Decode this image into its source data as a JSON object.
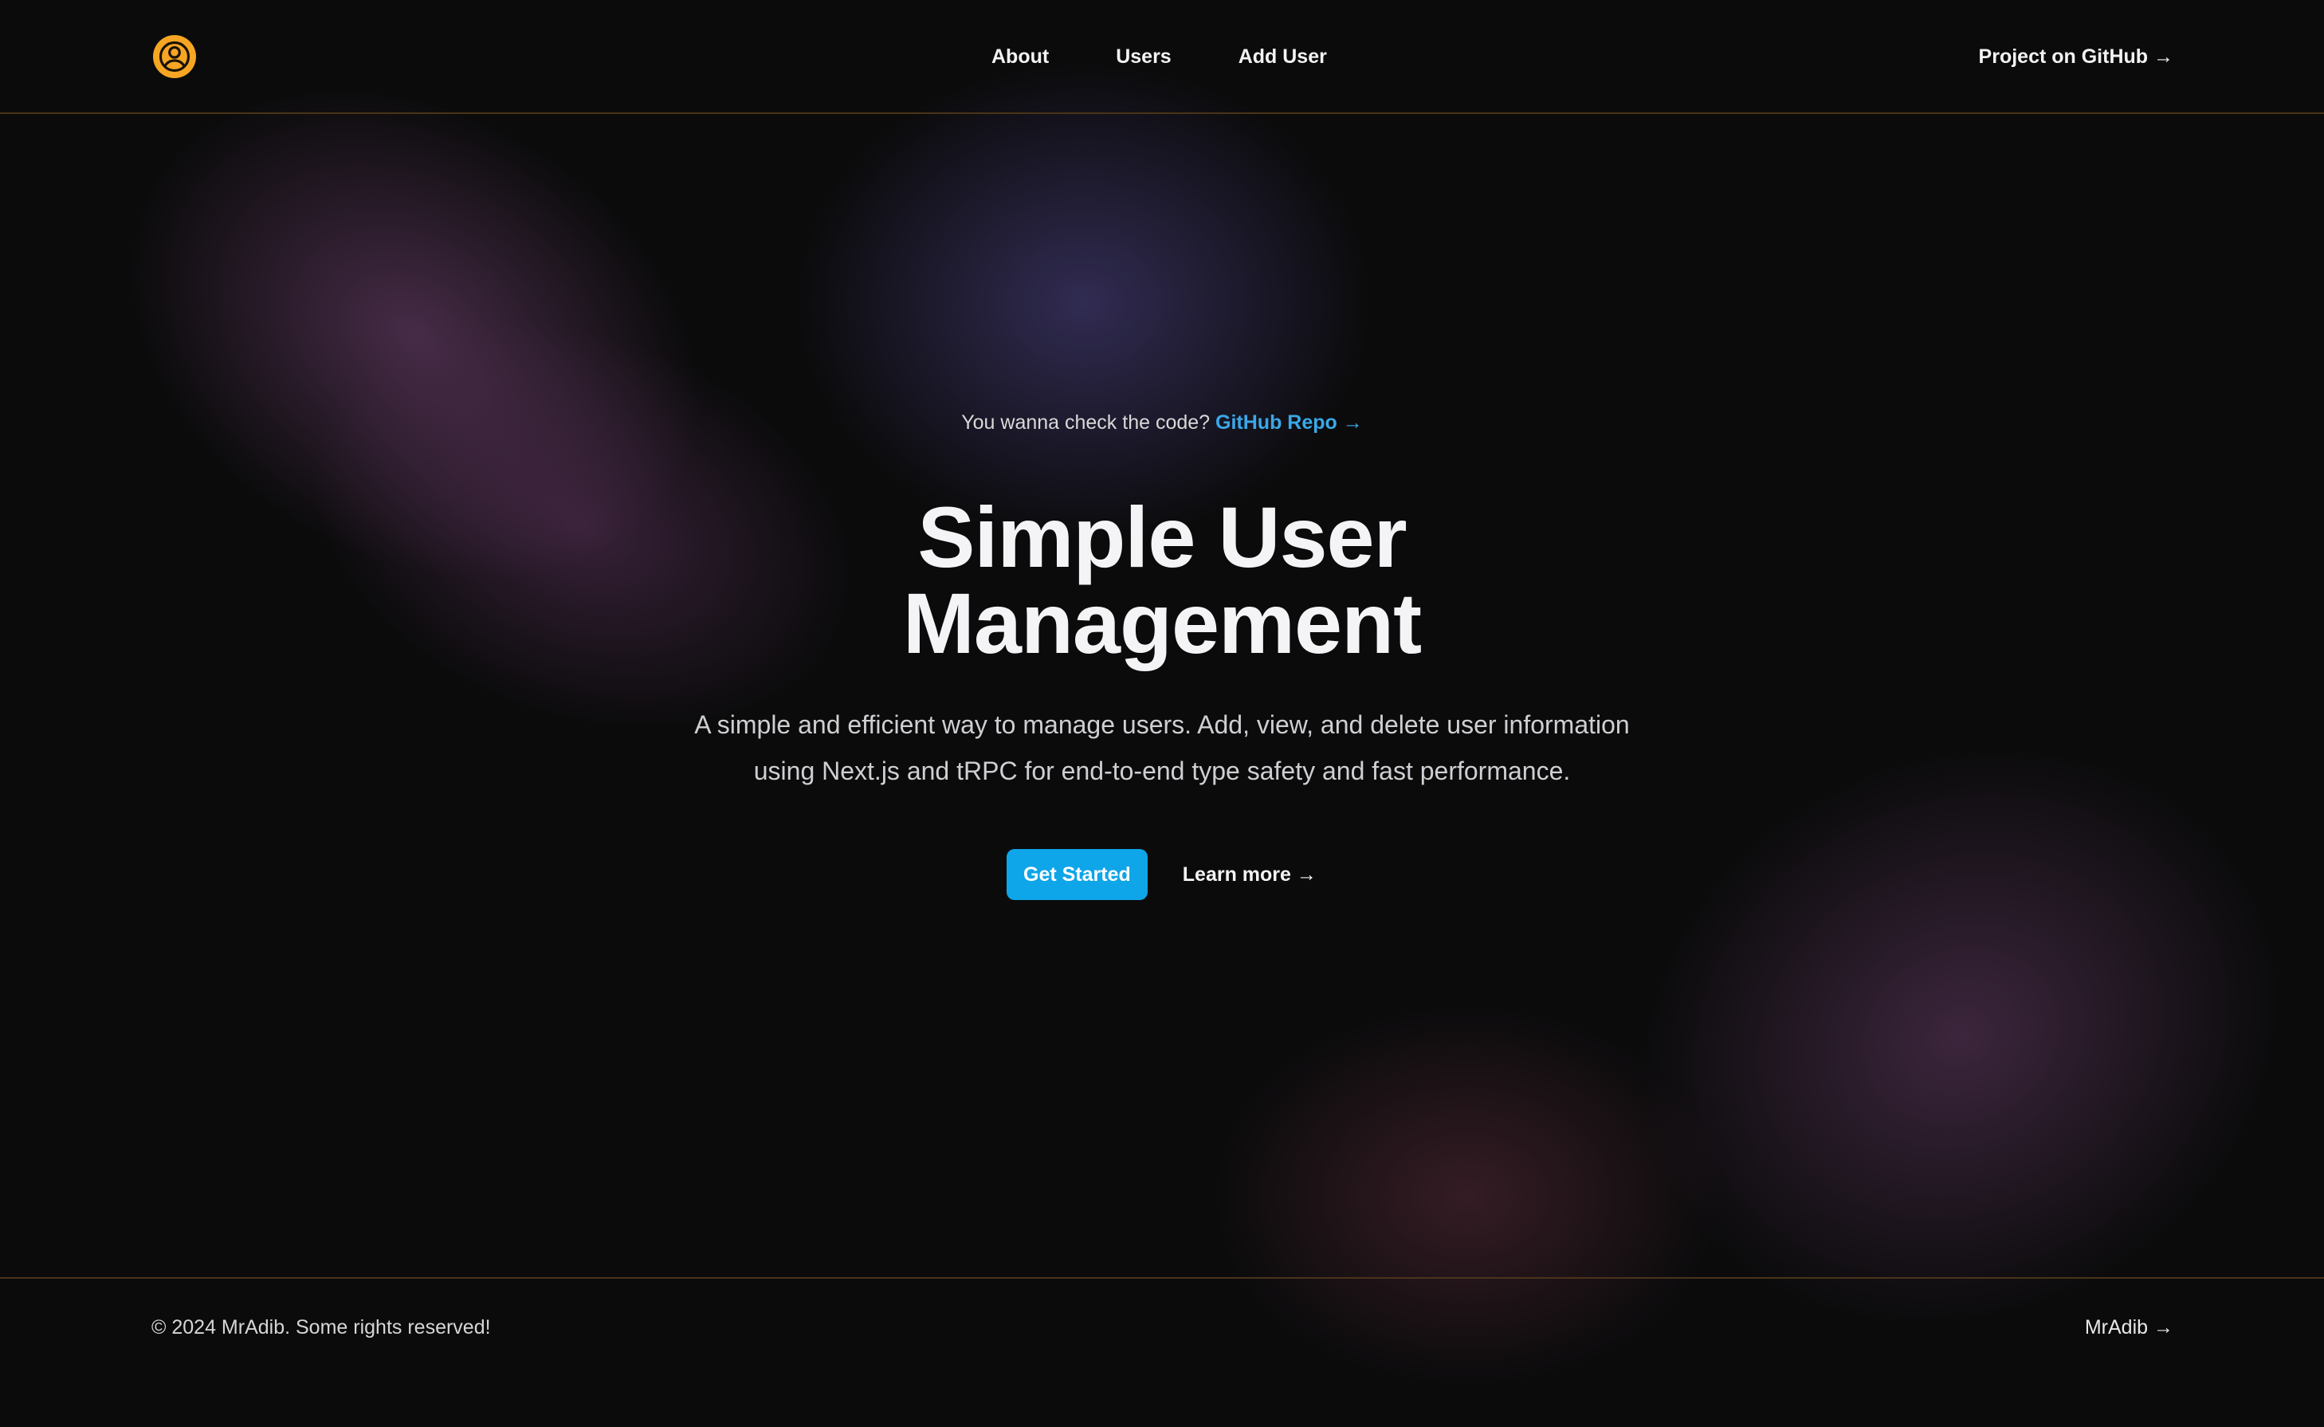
{
  "header": {
    "logo_icon": "user-circle-icon",
    "nav": [
      {
        "label": "About"
      },
      {
        "label": "Users"
      },
      {
        "label": "Add User"
      }
    ],
    "github_link": "Project on GitHub →"
  },
  "hero": {
    "check_text": "You wanna check the code?",
    "repo_link": "GitHub Repo →",
    "title_line1": "Simple User",
    "title_line2": "Management",
    "description_line1": "A simple and efficient way to manage users. Add, view, and delete user information",
    "description_line2": "using Next.js and tRPC for end-to-end type safety and fast performance.",
    "primary_button": "Get Started",
    "secondary_link": "Learn more →"
  },
  "footer": {
    "copyright": "© 2024 MrAdib. Some rights reserved!",
    "author_link": "MrAdib →"
  },
  "colors": {
    "background": "#0b0b0c",
    "accent": "#0ea5e9",
    "link": "#3aa8e8",
    "logo": "#f6a623",
    "divider": "#4a3418"
  }
}
